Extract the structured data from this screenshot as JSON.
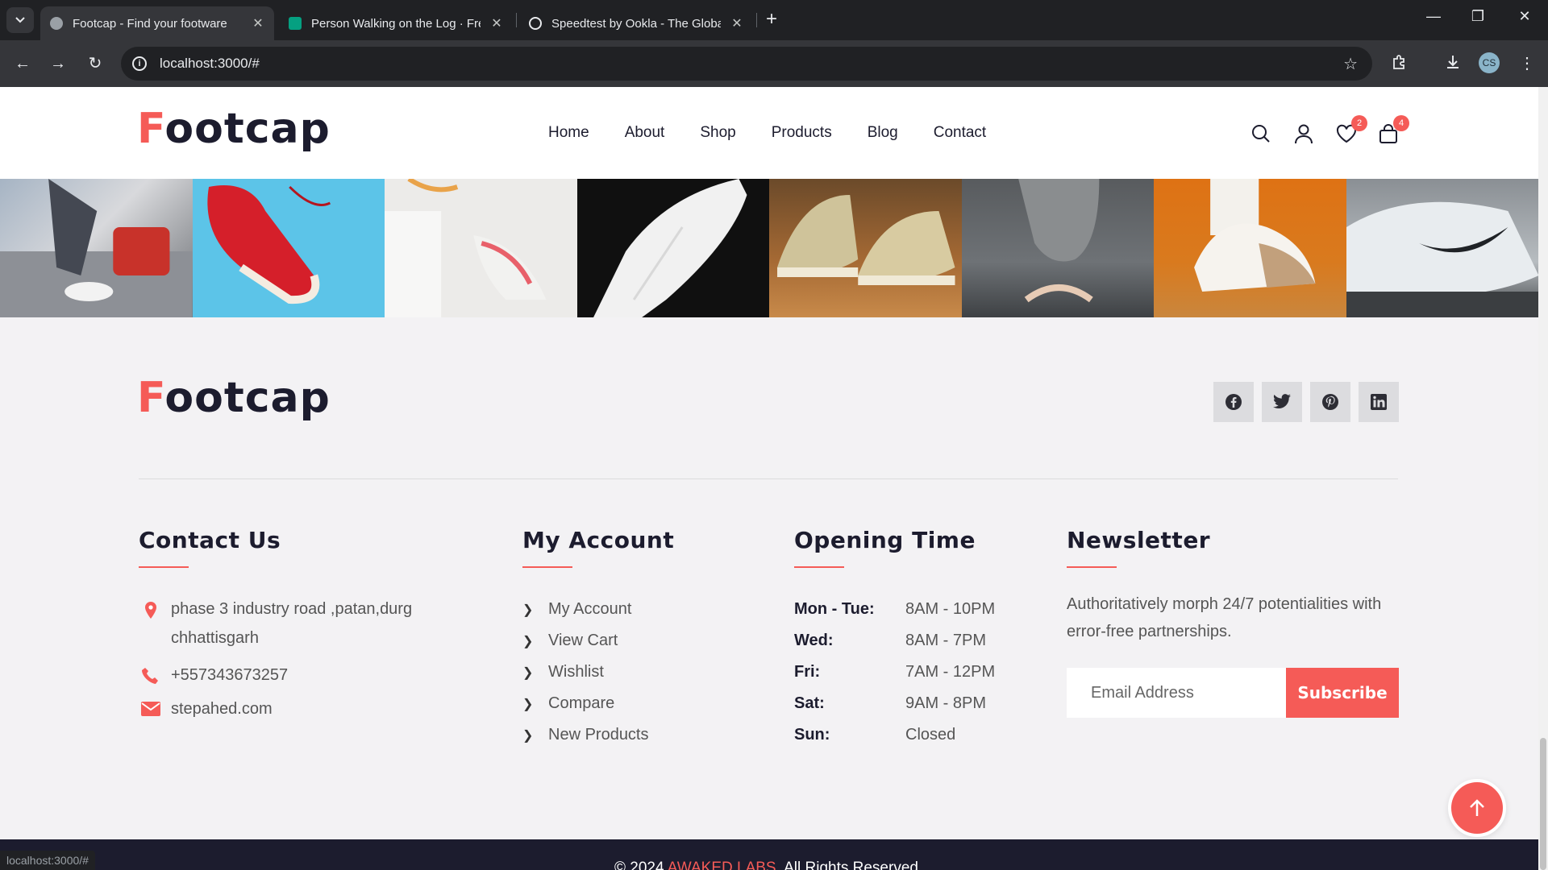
{
  "browser": {
    "tabs": [
      {
        "title": "Footcap - Find your footware",
        "active": true
      },
      {
        "title": "Person Walking on the Log · Free",
        "active": false
      },
      {
        "title": "Speedtest by Ookla - The Global",
        "active": false
      }
    ],
    "url": "localhost:3000/#",
    "profile_initials": "CS",
    "status_url": "localhost:3000/#"
  },
  "site": {
    "logo_first": "F",
    "logo_rest": "ootcap",
    "nav": [
      "Home",
      "About",
      "Shop",
      "Products",
      "Blog",
      "Contact"
    ],
    "wishlist_count": "2",
    "cart_count": "4"
  },
  "gallery": {
    "tiles": [
      "insta-1",
      "insta-2",
      "insta-3",
      "insta-4",
      "insta-5",
      "insta-6",
      "insta-7",
      "insta-8"
    ]
  },
  "footer": {
    "social_icons": [
      "facebook-icon",
      "twitter-icon",
      "pinterest-icon",
      "linkedin-icon"
    ],
    "contact": {
      "heading": "Contact Us",
      "address_line1": "phase 3 industry road ,patan,durg",
      "address_line2": "chhattisgarh",
      "phone": "+557343673257",
      "email": "stepahed.com"
    },
    "account": {
      "heading": "My Account",
      "links": [
        "My Account",
        "View Cart",
        "Wishlist",
        "Compare",
        "New Products"
      ]
    },
    "hours": {
      "heading": "Opening Time",
      "rows": [
        {
          "day": "Mon - Tue:",
          "time": "8AM - 10PM"
        },
        {
          "day": "Wed:",
          "time": "8AM - 7PM"
        },
        {
          "day": "Fri:",
          "time": "7AM - 12PM"
        },
        {
          "day": "Sat:",
          "time": "9AM - 8PM"
        },
        {
          "day": "Sun:",
          "time": "Closed"
        }
      ]
    },
    "newsletter": {
      "heading": "Newsletter",
      "text": "Authoritatively morph 24/7 potentialities with error-free partnerships.",
      "email_placeholder": "Email Address",
      "button": "Subscribe"
    },
    "copyright_prefix": "© 2024 ",
    "copyright_brand": "AWAKED LABS",
    "copyright_suffix": ". All Rights Reserved"
  },
  "colors": {
    "accent": "#f55b57",
    "dark": "#1c1c2e",
    "footer_bg": "#f3f2f4"
  }
}
